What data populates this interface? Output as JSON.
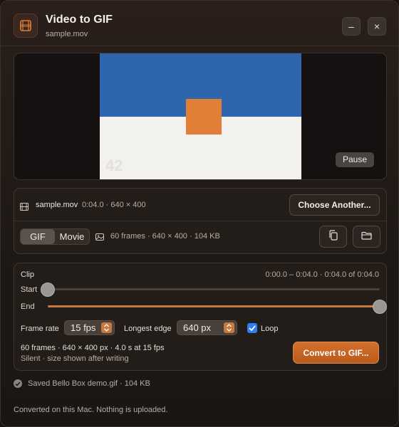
{
  "app": {
    "title": "Video to GIF",
    "subtitle": "sample.mov",
    "icon": "film-icon"
  },
  "window_controls": {
    "minimize": "–",
    "close": "×"
  },
  "preview": {
    "frame_counter": "42",
    "pause_label": "Pause",
    "colors": {
      "sky": "#2f65ad",
      "ground": "#f3f1ee",
      "box": "#e07f35"
    }
  },
  "source": {
    "file_name": "sample.mov",
    "file_meta": "0:04.0 · 640 × 400",
    "choose_label": "Choose Another..."
  },
  "output": {
    "formats": [
      "GIF",
      "Movie"
    ],
    "selected_format": "GIF",
    "meta": "60 frames · 640 × 400 · 104 KB"
  },
  "clip": {
    "label": "Clip",
    "range_text": "0:00.0 – 0:04.0 · 0:04.0 of 0:04.0",
    "start_label": "Start",
    "end_label": "End",
    "start_fraction": 0,
    "end_fraction": 1
  },
  "options": {
    "frame_rate_label": "Frame rate",
    "frame_rate_value": "15 fps",
    "longest_edge_label": "Longest edge",
    "longest_edge_value": "640 px",
    "loop_label": "Loop",
    "loop_checked": true
  },
  "summary": {
    "line1": "60 frames · 640 × 400 px · 4.0 s at 15 fps",
    "line2": "Silent · size shown after writing",
    "convert_label": "Convert to GIF..."
  },
  "status": {
    "saved_text": "Saved Bello Box demo.gif · 104 KB",
    "footer": "Converted on this Mac. Nothing is uploaded."
  },
  "accent": "#c77a40"
}
